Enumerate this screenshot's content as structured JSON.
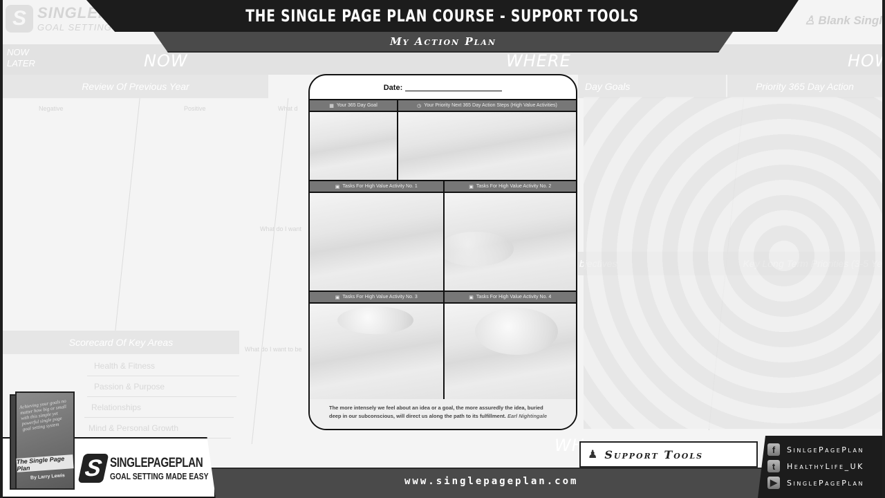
{
  "header": {
    "title": "THE SINGLE PAGE PLAN COURSE - SUPPORT TOOLS",
    "subtitle": "My Action Plan"
  },
  "background": {
    "logo_title": "SINGLEPAGE",
    "logo_tagline": "GOAL SETTING MADE",
    "user_label": "Blank Singl",
    "now_later": [
      "NOW",
      "LATER"
    ],
    "columns": [
      "NOW",
      "WHERE",
      "HOW"
    ],
    "section_heads": [
      "Review Of Previous Year",
      "Day Goals",
      "Priority 365 Day Action",
      "bjectives",
      "Key Long Term Priorities (3-5 Ye",
      "Scorecard Of Key Areas"
    ],
    "review_subheads": [
      "Negative",
      "Positive",
      "What d"
    ],
    "what_prompts": [
      "What do I want",
      "What do I want to be"
    ],
    "scorecard_rows": [
      "Health & Fitness",
      "Passion & Purpose",
      "Relationships",
      "Mind & Personal Growth"
    ],
    "bottom_words": [
      "WHY",
      "WH"
    ]
  },
  "action_plan": {
    "date_label": "Date:",
    "top_cells": [
      {
        "icon": "calendar-icon",
        "label": "Your 365 Day Goal"
      },
      {
        "icon": "clock-icon",
        "label": "Your Priority Next 365 Day Action Steps (High Value Activities)"
      }
    ],
    "task_cells": [
      {
        "icon": "briefcase-icon",
        "label": "Tasks For High Value Activity No. 1"
      },
      {
        "icon": "briefcase-icon",
        "label": "Tasks For High Value Activity No. 2"
      },
      {
        "icon": "briefcase-icon",
        "label": "Tasks For High Value Activity No. 3"
      },
      {
        "icon": "briefcase-icon",
        "label": "Tasks For High Value Activity No. 4"
      }
    ],
    "quote": "The more intensely we feel about an idea or a goal, the more assuredly the idea, buried deep in our subconscious, will direct us along the path to its fulfillment.",
    "quote_author": "Earl Nightingale"
  },
  "footer": {
    "brand_title": "SINGLEPAGEPLAN",
    "brand_tagline": "GOAL SETTING MADE EASY",
    "book_title": "The Single Page Plan",
    "book_author": "By Larry Lewis",
    "book_quote": "Achieving your goals no matter how big or small with this simple yet powerful single page goal setting system",
    "url": "www.singlepageplan.com",
    "support_label": "Support Tools",
    "social": [
      {
        "icon": "facebook-icon",
        "glyph": "f",
        "label": "SinlgePagePlan"
      },
      {
        "icon": "twitter-icon",
        "glyph": "t",
        "label": "HealthyLife_UK"
      },
      {
        "icon": "youtube-icon",
        "glyph": "▶",
        "label": "SinglePagePlan"
      }
    ]
  }
}
